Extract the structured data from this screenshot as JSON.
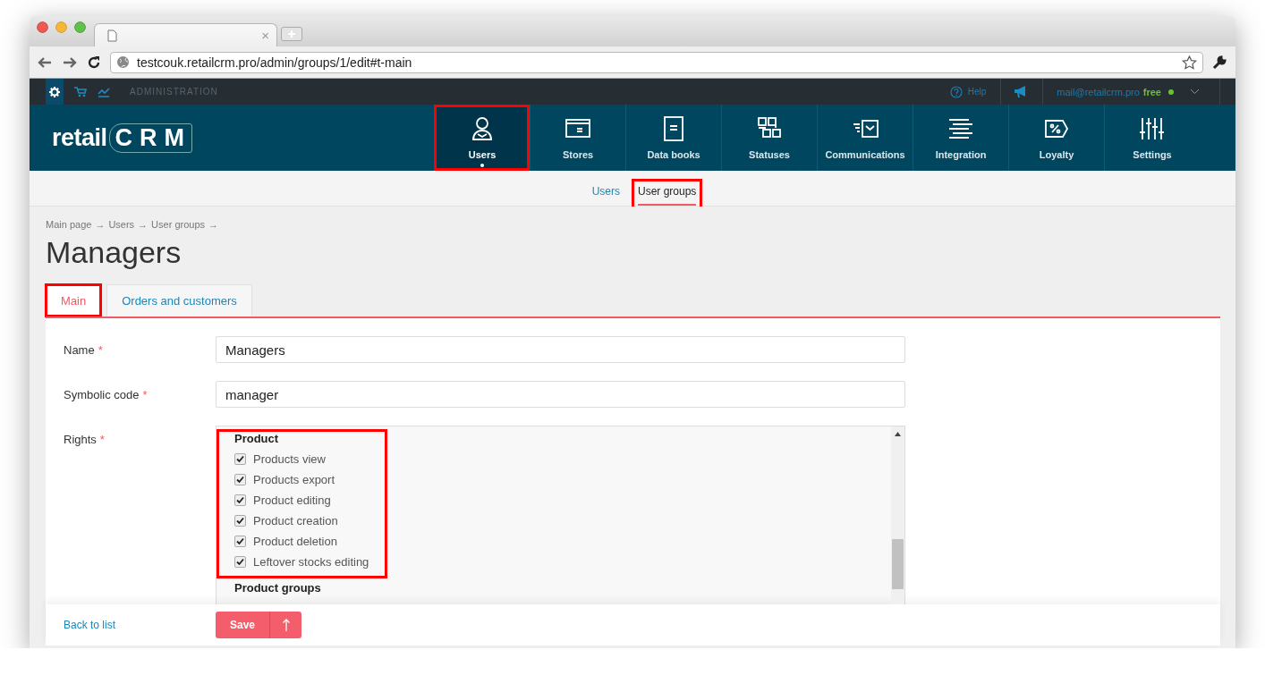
{
  "browser": {
    "tab_close": "×",
    "url": "testcouk.retailcrm.pro/admin/groups/1/edit#t-main"
  },
  "admin_bar": {
    "section": "ADMINISTRATION",
    "help": "Help",
    "email": "mail@retailcrm.pro",
    "plan": "free"
  },
  "logo": {
    "word": "retail",
    "mark": "CRM"
  },
  "nav": [
    {
      "label": "Users",
      "selected": true,
      "highlighted": true
    },
    {
      "label": "Stores",
      "selected": false,
      "highlighted": false
    },
    {
      "label": "Data books",
      "selected": false,
      "highlighted": false
    },
    {
      "label": "Statuses",
      "selected": false,
      "highlighted": false
    },
    {
      "label": "Communications",
      "selected": false,
      "highlighted": false
    },
    {
      "label": "Integration",
      "selected": false,
      "highlighted": false
    },
    {
      "label": "Loyalty",
      "selected": false,
      "highlighted": false
    },
    {
      "label": "Settings",
      "selected": false,
      "highlighted": false
    }
  ],
  "subnav": [
    {
      "label": "Users",
      "selected": false,
      "highlighted": false
    },
    {
      "label": "User groups",
      "selected": true,
      "highlighted": true
    }
  ],
  "breadcrumb": {
    "items": [
      "Main page",
      "Users",
      "User groups"
    ],
    "separator": "→"
  },
  "title": "Managers",
  "tabs": [
    {
      "label": "Main",
      "selected": true,
      "highlighted": true
    },
    {
      "label": "Orders and customers",
      "selected": false,
      "highlighted": false
    }
  ],
  "form": {
    "fields": [
      {
        "label": "Name",
        "required_mark": "*",
        "value": "Managers"
      },
      {
        "label": "Symbolic code",
        "required_mark": "*",
        "value": "manager"
      }
    ],
    "rights": {
      "label": "Rights",
      "required_mark": "*",
      "groups": [
        {
          "title": "Product",
          "highlighted": true,
          "items": [
            {
              "label": "Products view",
              "checked": true
            },
            {
              "label": "Products export",
              "checked": true
            },
            {
              "label": "Product editing",
              "checked": true
            },
            {
              "label": "Product creation",
              "checked": true
            },
            {
              "label": "Product deletion",
              "checked": true
            },
            {
              "label": "Leftover stocks editing",
              "checked": true
            }
          ]
        },
        {
          "title": "Product groups",
          "highlighted": false
        }
      ]
    }
  },
  "footer": {
    "back_link": "Back to list",
    "save": "Save"
  }
}
